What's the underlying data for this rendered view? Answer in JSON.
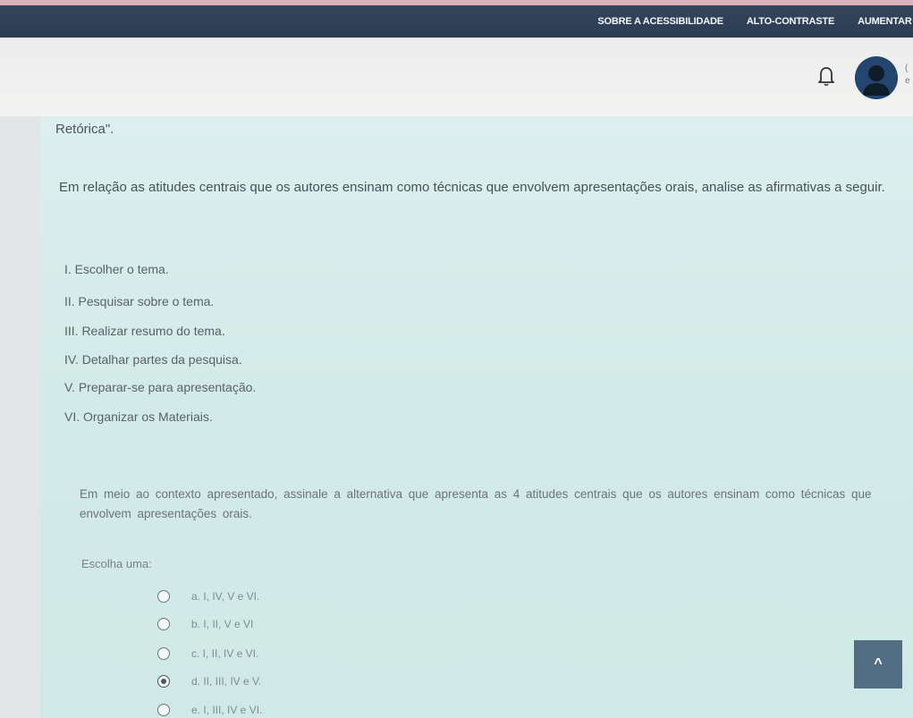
{
  "topbar": {
    "links": [
      "SOBRE A ACESSIBILIDADE",
      "ALTO-CONTRASTE",
      "AUMENTAR F"
    ]
  },
  "header": {
    "bell_icon": "bell-icon",
    "avatar_icon": "user-avatar-icon",
    "user_text_line1": "(",
    "user_text_line2": "e"
  },
  "question": {
    "title": "Retórica\".",
    "intro": "Em relação as atitudes centrais que os autores ensinam como técnicas que envolvem apresentações orais, analise as afirmativas a seguir.",
    "statements": [
      "I. Escolher o tema.",
      "II. Pesquisar sobre o tema.",
      "III. Realizar resumo do tema.",
      "IV. Detalhar partes da pesquisa.",
      "V. Preparar-se para apresentação.",
      "VI. Organizar os Materiais."
    ],
    "prompt": "Em meio ao contexto apresentado, assinale a alternativa que apresenta as 4 atitudes centrais que os autores ensinam como técnicas que envolvem apresentações orais.",
    "choose_label": "Escolha uma:",
    "options": [
      {
        "label": "a. I, IV, V e VI.",
        "checked": false
      },
      {
        "label": "b. I, II, V e VI",
        "checked": false
      },
      {
        "label": "c. I, II, IV e VI.",
        "checked": false
      },
      {
        "label": "d. II, III, IV e V.",
        "checked": true
      },
      {
        "label": "e. I, III, IV e VI.",
        "checked": false
      }
    ]
  },
  "scroll_top": {
    "label": "^"
  },
  "colors": {
    "topbar": "#2f4056",
    "content_bg": "#d5ece9",
    "scroll_button": "#536d84"
  }
}
